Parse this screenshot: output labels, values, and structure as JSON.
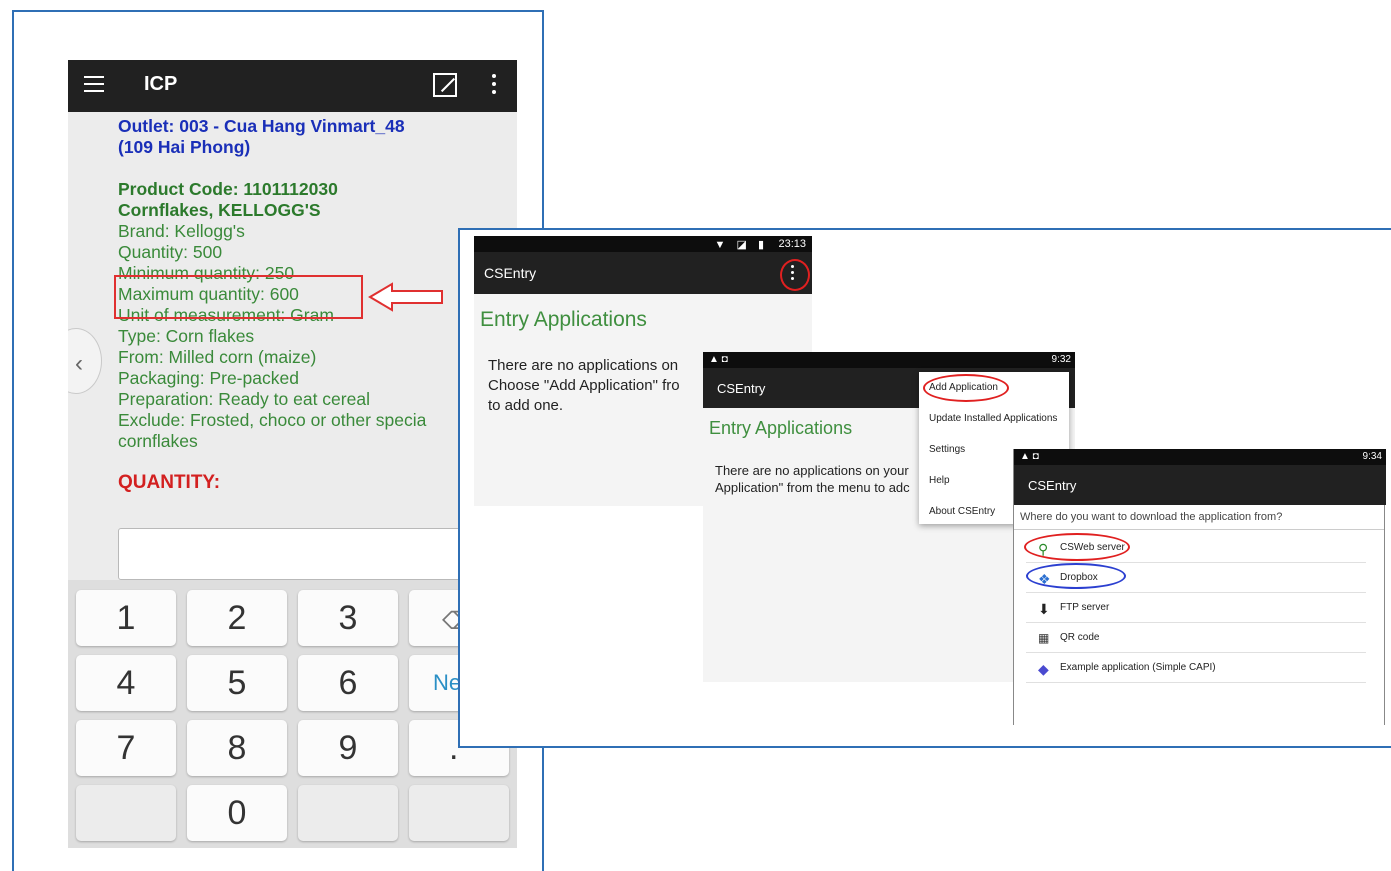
{
  "icp": {
    "title": "ICP",
    "outlet_line1": "Outlet: 003 - Cua Hang Vinmart_48",
    "outlet_line2": "(109 Hai Phong)",
    "product_code": "Product Code: 1101112030",
    "product_name": "Cornflakes, KELLOGG'S",
    "brand": "Brand:  Kellogg's",
    "quantity": "Quantity: 500",
    "min_quantity": "Minimum quantity:  250",
    "max_quantity": "Maximum quantity:  600",
    "unit": "Unit of measurement:  Gram",
    "type": "Type:  Corn flakes",
    "from": "From:  Milled corn (maize)",
    "packaging": "Packaging:  Pre-packed",
    "preparation": "Preparation:  Ready to eat cereal",
    "exclude_line1": "Exclude:  Frosted, choco or other specia",
    "exclude_line2": "cornflakes",
    "qty_label": "QUANTITY:",
    "input_value": "",
    "keys": [
      "1",
      "2",
      "3",
      "4",
      "5",
      "6",
      "7",
      "8",
      "9",
      "0"
    ],
    "next_label": "Ne",
    "dot_label": "."
  },
  "screen1": {
    "status_time": "23:13",
    "status_icons": "▼ ◪ ▮",
    "app_title": "CSEntry",
    "heading": "Entry Applications",
    "msg_line1": "There are no applications on",
    "msg_line2": "Choose \"Add Application\" fro",
    "msg_line3": "to add one."
  },
  "screen2": {
    "status_left": "▲ ◘",
    "status_time": "9:32",
    "app_title": "CSEntry",
    "heading": "Entry Applications",
    "msg_line1": "There are no applications on your",
    "msg_line2": "Application\" from the menu to adc",
    "menu": [
      "Add Application",
      "Update Installed Applications",
      "Settings",
      "Help",
      "About CSEntry"
    ]
  },
  "screen3": {
    "status_left": "▲ ◘",
    "status_time": "9:34",
    "app_title": "CSEntry",
    "question": "Where do you want to download the application from?",
    "options": [
      "CSWeb server",
      "Dropbox",
      "FTP server",
      "QR code",
      "Example application (Simple CAPI)"
    ]
  },
  "colors": {
    "frame_border": "#2f6fb5",
    "outlet_blue": "#1a2fb8",
    "attr_green": "#3a8a3a",
    "highlight_red": "#e03030",
    "dropbox_blue": "#2b3fd0"
  }
}
